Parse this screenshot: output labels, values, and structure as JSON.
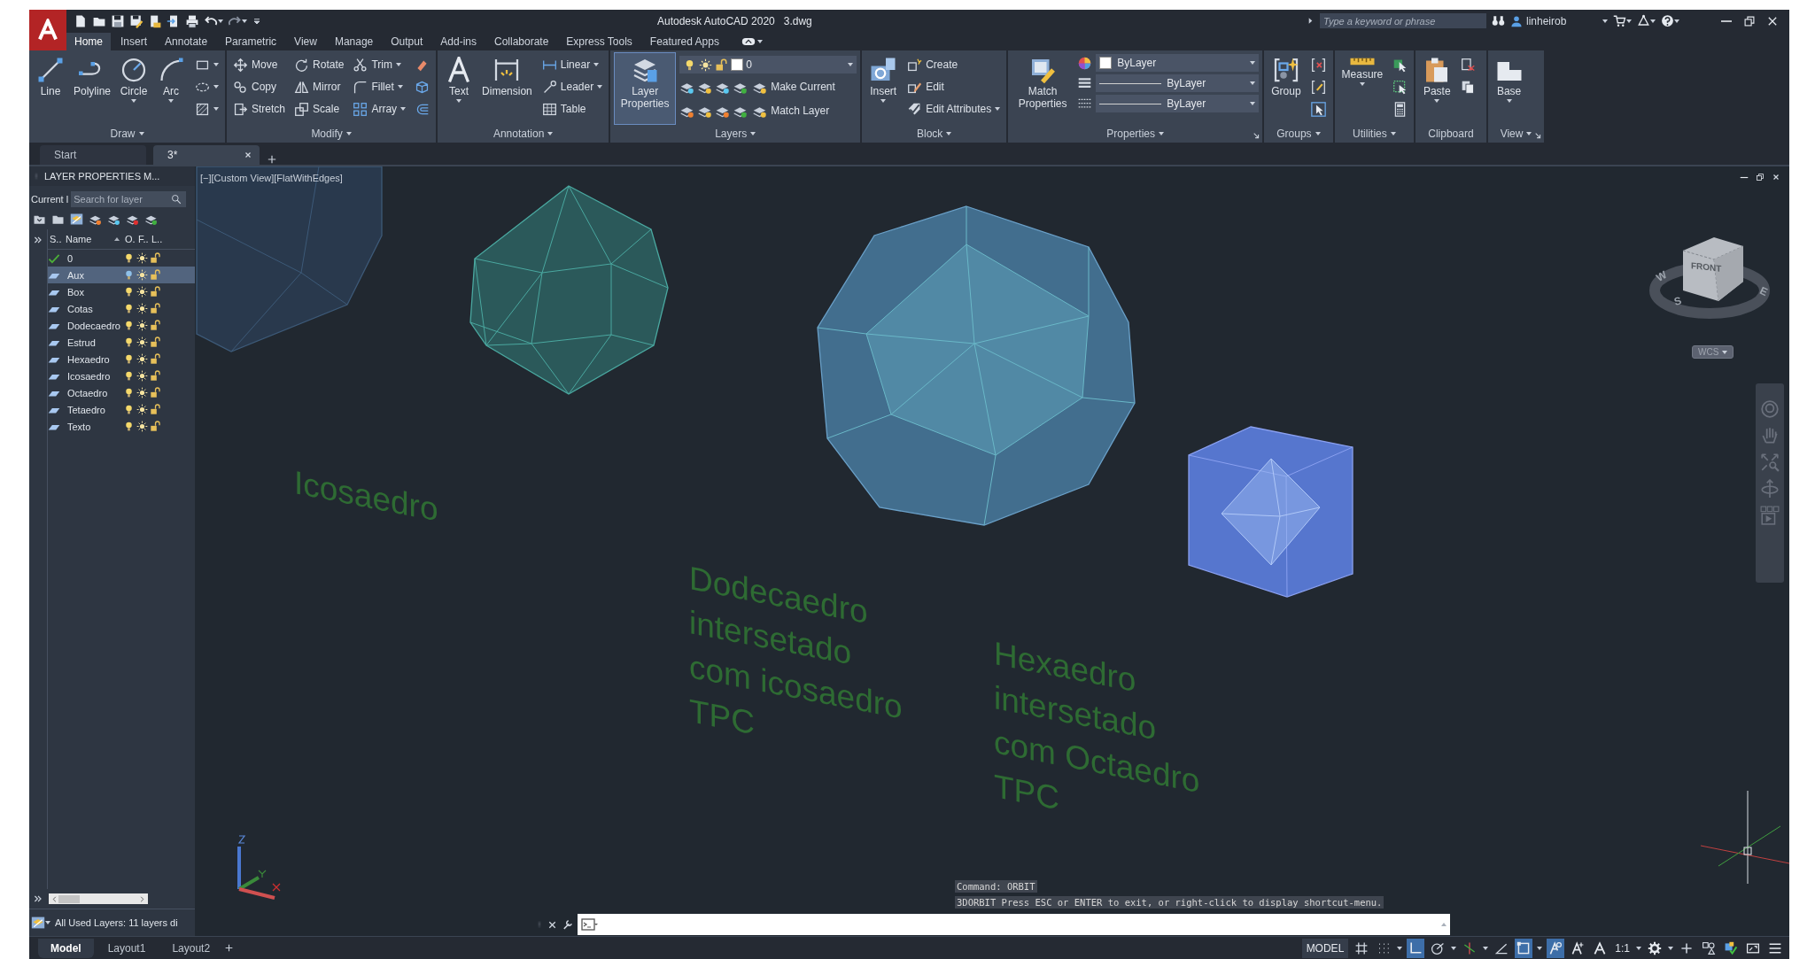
{
  "title_bar": {
    "app_name": "Autodesk AutoCAD 2020",
    "file_name": "3.dwg",
    "search": {
      "placeholder": "Type a keyword or phrase"
    },
    "user": "linheirob"
  },
  "ribbon_tabs": [
    {
      "label": "Home",
      "selected": true
    },
    {
      "label": "Insert",
      "selected": false
    },
    {
      "label": "Annotate",
      "selected": false
    },
    {
      "label": "Parametric",
      "selected": false
    },
    {
      "label": "View",
      "selected": false
    },
    {
      "label": "Manage",
      "selected": false
    },
    {
      "label": "Output",
      "selected": false
    },
    {
      "label": "Add-ins",
      "selected": false
    },
    {
      "label": "Collaborate",
      "selected": false
    },
    {
      "label": "Express Tools",
      "selected": false
    },
    {
      "label": "Featured Apps",
      "selected": false
    }
  ],
  "ribbon_panels": [
    {
      "title": "Draw",
      "menu": true,
      "launcher": false,
      "columns": [
        {
          "kind": "large",
          "items": [
            {
              "label": "Line",
              "dropdown": false,
              "active": false
            },
            {
              "label": "Polyline",
              "dropdown": false,
              "active": false
            },
            {
              "label": "Circle",
              "dropdown": true,
              "active": false
            },
            {
              "label": "Arc",
              "dropdown": true,
              "active": false
            }
          ]
        },
        {
          "kind": "stack",
          "items": [
            {
              "dropdown": true
            },
            {
              "dropdown": true
            },
            {
              "dropdown": true
            }
          ]
        }
      ]
    },
    {
      "title": "Modify",
      "menu": true,
      "launcher": false,
      "columns": [
        {
          "kind": "stack",
          "items": [
            {
              "label": "Move",
              "dropdown": false
            },
            {
              "label": "Copy",
              "dropdown": false
            },
            {
              "label": "Stretch",
              "dropdown": false
            }
          ]
        },
        {
          "kind": "stack",
          "items": [
            {
              "label": "Rotate",
              "dropdown": false
            },
            {
              "label": "Mirror",
              "dropdown": false
            },
            {
              "label": "Scale",
              "dropdown": false
            }
          ]
        },
        {
          "kind": "stack",
          "items": [
            {
              "label": "Trim",
              "dropdown": true
            },
            {
              "label": "Fillet",
              "dropdown": true
            },
            {
              "label": "Array",
              "dropdown": true
            }
          ]
        },
        {
          "kind": "stack",
          "items": [
            {
              "dropdown": false
            },
            {
              "dropdown": false
            },
            {
              "dropdown": false
            }
          ]
        }
      ]
    },
    {
      "title": "Annotation",
      "menu": true,
      "launcher": false,
      "columns": [
        {
          "kind": "large",
          "items": [
            {
              "label": "Text",
              "dropdown": true,
              "active": false
            },
            {
              "label": "Dimension",
              "dropdown": false,
              "active": false
            }
          ]
        },
        {
          "kind": "stack",
          "items": [
            {
              "label": "Linear",
              "dropdown": true
            },
            {
              "label": "Leader",
              "dropdown": true
            },
            {
              "label": "Table",
              "dropdown": false
            }
          ]
        }
      ]
    },
    {
      "title": "Layers",
      "menu": true,
      "launcher": false,
      "columns": [
        {
          "kind": "large",
          "items": [
            {
              "label": "Layer Properties",
              "dropdown": false,
              "active": true
            }
          ]
        },
        {
          "kind": "layers",
          "combo": {
            "value": "0",
            "on": true,
            "frozen": false,
            "locked": false,
            "color": "#ffffff"
          },
          "items": [
            {
              "label": "Make Current"
            },
            {
              "label": "Match Layer"
            }
          ]
        }
      ]
    },
    {
      "title": "Block",
      "menu": true,
      "launcher": false,
      "columns": [
        {
          "kind": "large",
          "items": [
            {
              "label": "Insert",
              "dropdown": true,
              "active": false
            }
          ]
        },
        {
          "kind": "stack",
          "items": [
            {
              "label": "Create",
              "dropdown": false
            },
            {
              "label": "Edit",
              "dropdown": false
            },
            {
              "label": "Edit Attributes",
              "dropdown": true
            }
          ]
        }
      ]
    },
    {
      "title": "Properties",
      "menu": true,
      "launcher": true,
      "columns": [
        {
          "kind": "large",
          "items": [
            {
              "label": "Match Properties",
              "dropdown": false,
              "active": false
            }
          ]
        },
        {
          "kind": "properties",
          "items": [
            {
              "kind": "color",
              "value": "ByLayer"
            },
            {
              "kind": "lineweight",
              "value": "ByLayer"
            },
            {
              "kind": "linetype",
              "value": "ByLayer"
            }
          ]
        }
      ]
    },
    {
      "title": "Groups",
      "menu": true,
      "launcher": false,
      "columns": [
        {
          "kind": "large",
          "items": [
            {
              "label": "Group",
              "dropdown": false,
              "active": false
            }
          ]
        },
        {
          "kind": "stack",
          "items": [
            {
              "dropdown": false
            },
            {
              "dropdown": false
            },
            {
              "dropdown": false
            }
          ]
        }
      ]
    },
    {
      "title": "Utilities",
      "menu": true,
      "launcher": false,
      "columns": [
        {
          "kind": "large",
          "items": [
            {
              "label": "Measure",
              "dropdown": true,
              "active": false
            }
          ]
        },
        {
          "kind": "stack",
          "items": [
            {
              "dropdown": false
            },
            {
              "dropdown": false
            },
            {
              "dropdown": false
            }
          ]
        }
      ]
    },
    {
      "title": "Clipboard",
      "menu": false,
      "launcher": false,
      "columns": [
        {
          "kind": "large",
          "items": [
            {
              "label": "Paste",
              "dropdown": true,
              "active": false
            }
          ]
        },
        {
          "kind": "stack",
          "items": [
            {
              "dropdown": false
            },
            {
              "dropdown": false
            }
          ]
        }
      ]
    },
    {
      "title": "View",
      "menu": true,
      "launcher": true,
      "columns": [
        {
          "kind": "large",
          "items": [
            {
              "label": "Base",
              "dropdown": true,
              "active": false
            }
          ]
        }
      ]
    }
  ],
  "doc_tabs": [
    {
      "label": "Start",
      "selected": false,
      "closable": false
    },
    {
      "label": "3*",
      "selected": true,
      "closable": true
    }
  ],
  "layer_manager": {
    "title": "LAYER PROPERTIES M...",
    "current_label": "Current l",
    "search": {
      "placeholder": "Search for layer"
    },
    "columns": [
      "S..",
      "Name",
      "O.",
      "F..",
      "L.."
    ],
    "layers": [
      {
        "name": "0",
        "current": true,
        "selected": false,
        "on": true,
        "frozen": false,
        "locked": false
      },
      {
        "name": "Aux",
        "current": false,
        "selected": true,
        "on": true,
        "frozen": false,
        "locked": false
      },
      {
        "name": "Box",
        "current": false,
        "selected": false,
        "on": true,
        "frozen": false,
        "locked": false
      },
      {
        "name": "Cotas",
        "current": false,
        "selected": false,
        "on": true,
        "frozen": false,
        "locked": false
      },
      {
        "name": "Dodecaedro",
        "current": false,
        "selected": false,
        "on": true,
        "frozen": false,
        "locked": false
      },
      {
        "name": "Estrud",
        "current": false,
        "selected": false,
        "on": true,
        "frozen": false,
        "locked": false
      },
      {
        "name": "Hexaedro",
        "current": false,
        "selected": false,
        "on": true,
        "frozen": false,
        "locked": false
      },
      {
        "name": "Icosaedro",
        "current": false,
        "selected": false,
        "on": true,
        "frozen": false,
        "locked": false
      },
      {
        "name": "Octaedro",
        "current": false,
        "selected": false,
        "on": true,
        "frozen": false,
        "locked": false
      },
      {
        "name": "Tetaedro",
        "current": false,
        "selected": false,
        "on": true,
        "frozen": false,
        "locked": false
      },
      {
        "name": "Texto",
        "current": false,
        "selected": false,
        "on": true,
        "frozen": false,
        "locked": false
      }
    ],
    "footer": "All Used Layers: 11 layers di"
  },
  "viewport": {
    "label": "[−][Custom View][FlatWithEdges]",
    "annotations": [
      {
        "lines": [
          "Icosaedro"
        ]
      },
      {
        "lines": [
          "Dodecaedro",
          "intersetado",
          "com icosaedro",
          "TPC"
        ]
      },
      {
        "lines": [
          "Hexaedro",
          "intersetado",
          "com Octaedro",
          "TPC"
        ]
      }
    ],
    "viewcube": {
      "face": "FRONT",
      "compass": [
        "W",
        "S",
        "E"
      ],
      "ucs": "WCS"
    }
  },
  "command_line": {
    "history": [
      "Command: ORBIT",
      "3DORBIT Press ESC or ENTER to exit, or right-click to display shortcut-menu."
    ]
  },
  "layout_tabs": [
    {
      "label": "Model",
      "selected": true
    },
    {
      "label": "Layout1",
      "selected": false
    },
    {
      "label": "Layout2",
      "selected": false
    }
  ],
  "status_bar": {
    "mode": "MODEL",
    "scale": "1:1",
    "toggles": [
      {
        "on": false
      },
      {
        "on": false
      },
      {
        "on": true
      },
      {
        "on": false
      },
      {
        "on": false
      },
      {
        "on": false
      },
      {
        "on": true
      },
      {
        "on": true
      },
      {
        "on": false
      },
      {
        "on": false
      }
    ]
  }
}
